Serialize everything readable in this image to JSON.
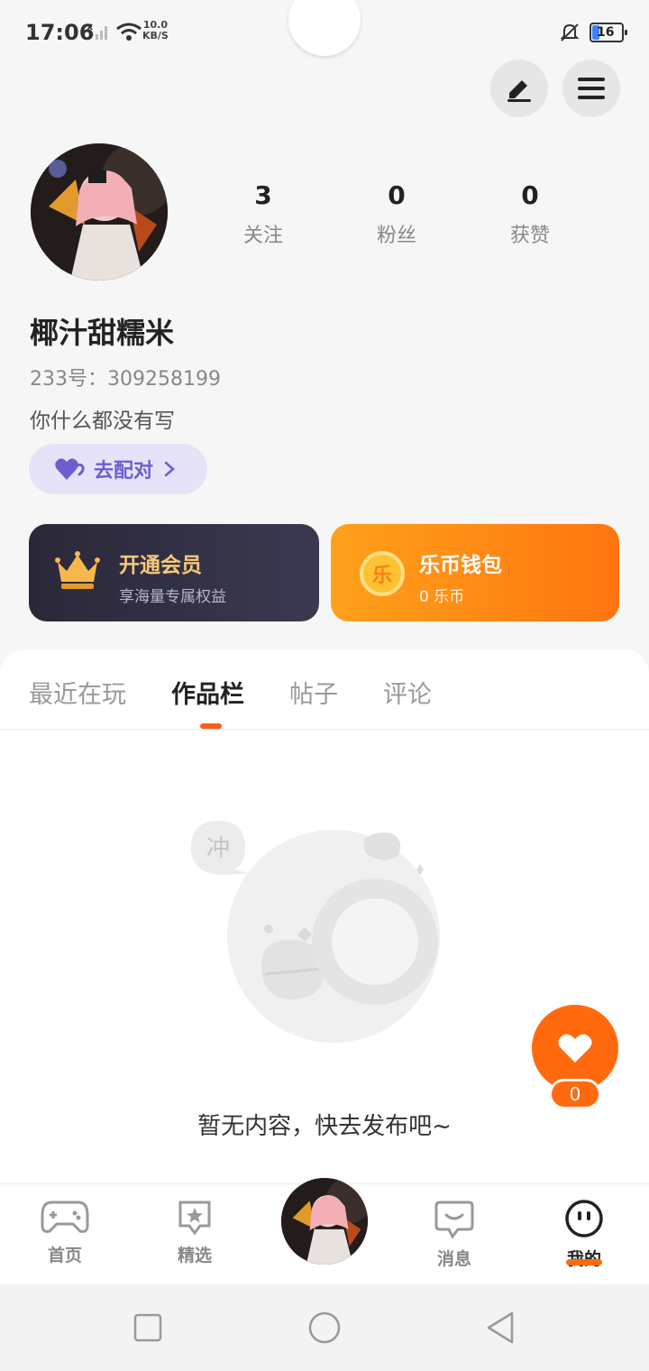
{
  "status_bar": {
    "time": "17:06",
    "net_speed_top": "10.0",
    "net_speed_unit": "KB/S",
    "battery": "16"
  },
  "profile": {
    "stats": [
      {
        "value": "3",
        "label": "关注"
      },
      {
        "value": "0",
        "label": "粉丝"
      },
      {
        "value": "0",
        "label": "获赞"
      }
    ],
    "username": "椰汁甜糯米",
    "uid": "233号：309258199",
    "bio": "你什么都没有写",
    "match_button": "去配对"
  },
  "cards": {
    "vip": {
      "title": "开通会员",
      "subtitle": "享海量专属权益"
    },
    "wallet": {
      "title": "乐币钱包",
      "subtitle": "0 乐币",
      "coin_glyph": "乐"
    }
  },
  "tabs": [
    "最近在玩",
    "作品栏",
    "帖子",
    "评论"
  ],
  "active_tab": "作品栏",
  "empty": {
    "bubble_glyph": "冲",
    "message": "暂无内容，快去发布吧~"
  },
  "like_fab": {
    "count": "0"
  },
  "bottom_nav": {
    "items": [
      {
        "label": "首页"
      },
      {
        "label": "精选"
      },
      {
        "label": "消息"
      },
      {
        "label": "我的"
      }
    ],
    "active": "我的"
  },
  "colors": {
    "accent": "#ff6a0e",
    "match": "#6b5fd0",
    "vip_gold": "#f5c87a"
  }
}
